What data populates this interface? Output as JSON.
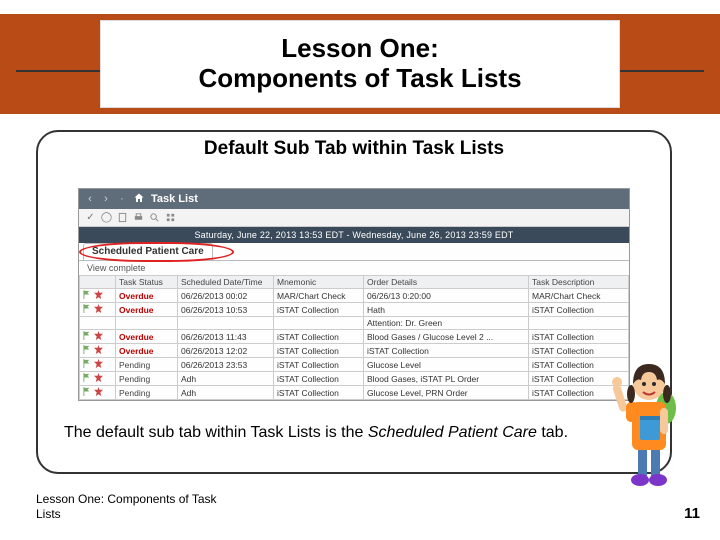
{
  "title": "Lesson One:\nComponents of Task Lists",
  "subtitle": "Default Sub Tab within Task Lists",
  "mock": {
    "app_title": "Task List",
    "date_bar": "Saturday, June 22, 2013 13:53 EDT  -  Wednesday, June 26, 2013 23:59 EDT",
    "tab_label": "Scheduled Patient Care",
    "subline": "View complete",
    "columns": [
      "",
      "Task Status",
      "Scheduled Date/Time",
      "Mnemonic",
      "Order Details",
      "Task Description"
    ],
    "rows": [
      {
        "status": "Overdue",
        "status_cls": "status-overdue",
        "dt": "06/26/2013   00:02",
        "mn": "MAR/Chart Check",
        "od": "06/26/13 0:20:00",
        "td": "MAR/Chart Check"
      },
      {
        "status": "Overdue",
        "status_cls": "status-overdue",
        "dt": "06/26/2013   10:53",
        "mn": "iSTAT Collection",
        "od": "Hath",
        "td": "iSTAT Collection"
      },
      {
        "status": "",
        "status_cls": "",
        "dt": "",
        "mn": "",
        "od": "Attention: Dr. Green",
        "td": ""
      },
      {
        "status": "Overdue",
        "status_cls": "status-overdue",
        "dt": "06/26/2013   11:43",
        "mn": "iSTAT Collection",
        "od": "Blood Gases / Glucose Level 2 ...",
        "td": "iSTAT Collection"
      },
      {
        "status": "Overdue",
        "status_cls": "status-overdue",
        "dt": "06/26/2013   12:02",
        "mn": "iSTAT Collection",
        "od": "iSTAT Collection",
        "td": "iSTAT Collection"
      },
      {
        "status": "Pending",
        "status_cls": "status-pending",
        "dt": "06/26/2013   23:53",
        "mn": "iSTAT Collection",
        "od": "Glucose Level",
        "td": "iSTAT Collection"
      },
      {
        "status": "Pending",
        "status_cls": "status-pending",
        "dt": "Adh",
        "mn": "iSTAT Collection",
        "od": "Blood Gases, iSTAT PL Order",
        "td": "iSTAT Collection"
      },
      {
        "status": "Pending",
        "status_cls": "status-pending",
        "dt": "Adh",
        "mn": "iSTAT Collection",
        "od": "Glucose Level, PRN Order",
        "td": "iSTAT Collection"
      }
    ]
  },
  "body_pre": "The default sub tab within Task Lists is the ",
  "body_italic": "Scheduled Patient Care",
  "body_post": " tab.",
  "footer_left": "Lesson One: Components of Task Lists",
  "page_number": "11"
}
